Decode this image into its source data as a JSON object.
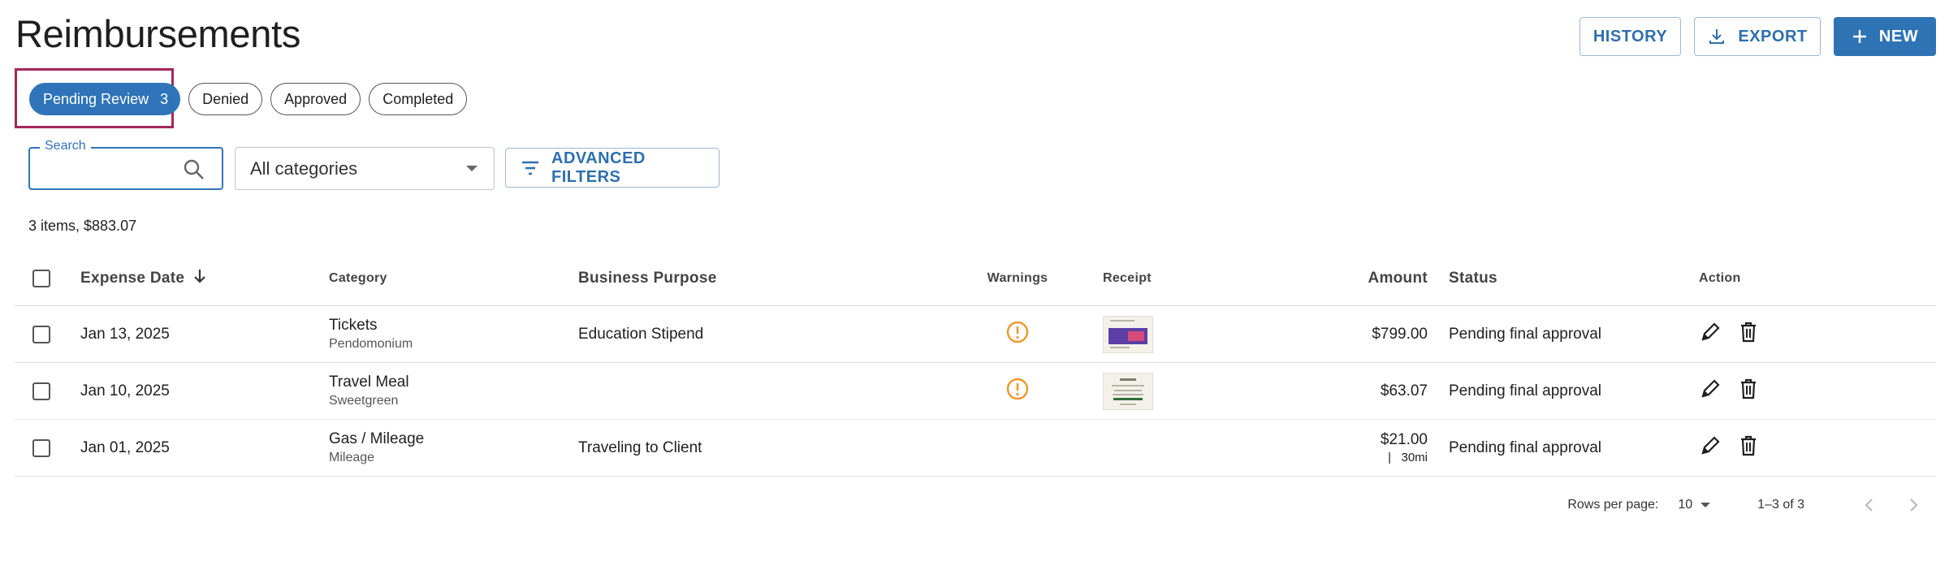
{
  "page": {
    "title": "Reimbursements"
  },
  "actions": {
    "history": "HISTORY",
    "export": "EXPORT",
    "new": "NEW"
  },
  "tabs": [
    {
      "label": "Pending Review",
      "count": "3",
      "active": true
    },
    {
      "label": "Denied"
    },
    {
      "label": "Approved"
    },
    {
      "label": "Completed"
    }
  ],
  "filters": {
    "search_label": "Search",
    "search_value": "",
    "category_selected": "All categories",
    "advanced_label": "ADVANCED FILTERS"
  },
  "summary": "3 items, $883.07",
  "table": {
    "headers": {
      "date": "Expense Date",
      "category": "Category",
      "purpose": "Business Purpose",
      "warnings": "Warnings",
      "receipt": "Receipt",
      "amount": "Amount",
      "status": "Status",
      "action": "Action"
    },
    "rows": [
      {
        "date": "Jan 13, 2025",
        "category": "Tickets",
        "merchant": "Pendomonium",
        "purpose": "Education Stipend",
        "warning": true,
        "receipt": "ticket-receipt",
        "amount": "$799.00",
        "status": "Pending final approval"
      },
      {
        "date": "Jan 10, 2025",
        "category": "Travel Meal",
        "merchant": "Sweetgreen",
        "purpose": "",
        "warning": true,
        "receipt": "meal-receipt",
        "amount": "$63.07",
        "status": "Pending final approval"
      },
      {
        "date": "Jan 01, 2025",
        "category": "Gas / Mileage",
        "merchant": "Mileage",
        "purpose": "Traveling to Client",
        "warning": false,
        "receipt": "",
        "amount": "$21.00",
        "mileage": "|   30mi",
        "status": "Pending final approval"
      }
    ]
  },
  "pagination": {
    "rows_label": "Rows per page:",
    "rows_value": "10",
    "range": "1–3 of 3"
  },
  "colors": {
    "primary": "#2f74b8",
    "warning": "#f0962e",
    "highlight": "#a4275c"
  },
  "icons": [
    "download-icon",
    "plus-icon",
    "search-icon",
    "filter-icon",
    "arrow-down-icon",
    "warning-icon",
    "pencil-icon",
    "trash-icon",
    "chevron-left-icon",
    "chevron-right-icon"
  ]
}
